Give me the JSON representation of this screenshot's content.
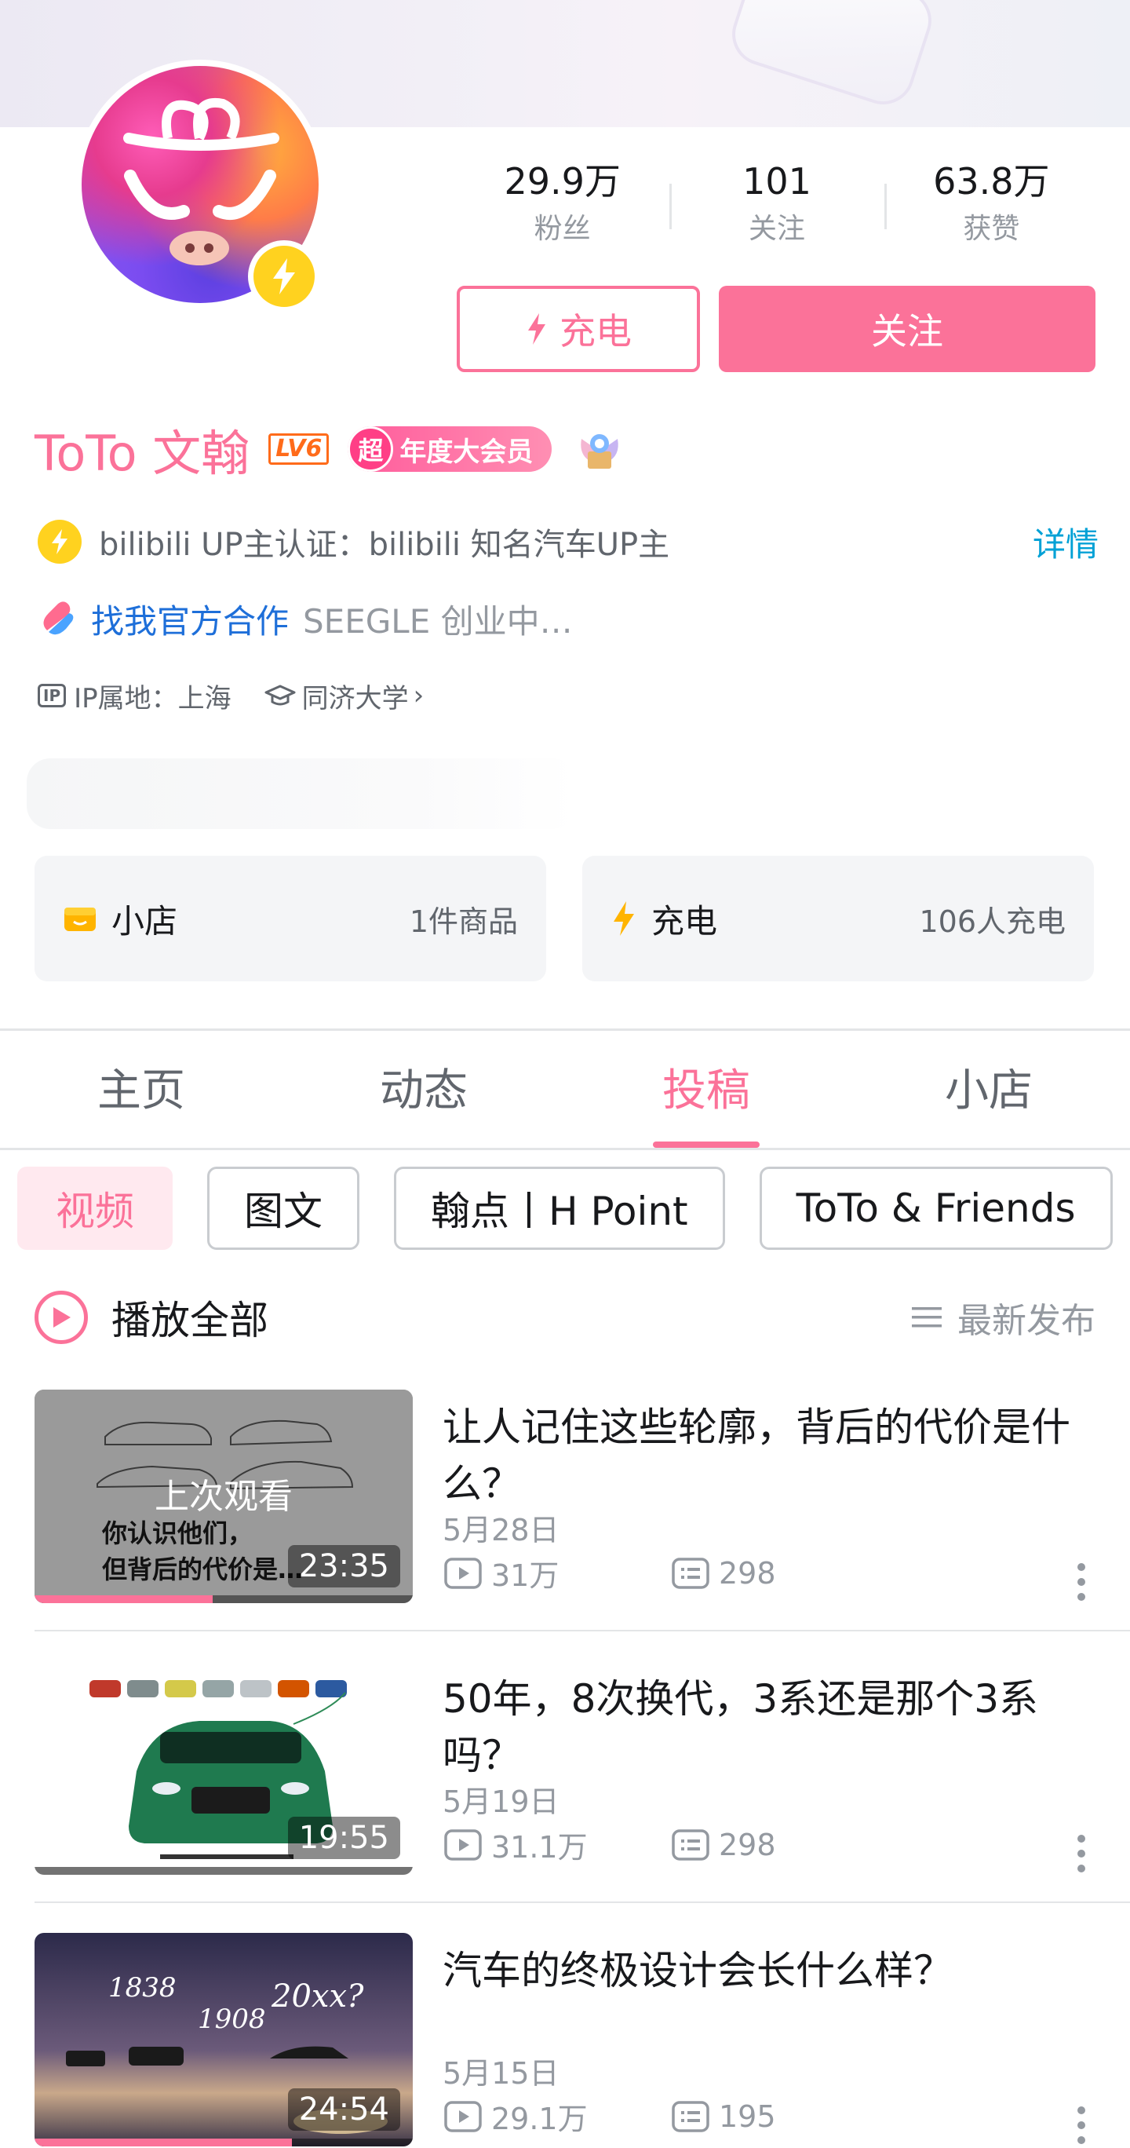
{
  "profile": {
    "name": "ToTo 文翰",
    "level": "LV6",
    "vip_prefix": "超",
    "vip_label": "年度大会员",
    "certification": "bilibili UP主认证：bilibili 知名汽车UP主",
    "certification_more": "详情",
    "cooperation_link": "找我官方合作",
    "cooperation_desc": "SEEGLE 创业中…",
    "ip_badge": "IP",
    "ip_location": "IP属地：上海",
    "school": "同济大学",
    "school_chevron": "›"
  },
  "stats": [
    {
      "value": "29.9万",
      "label": "粉丝"
    },
    {
      "value": "101",
      "label": "关注"
    },
    {
      "value": "63.8万",
      "label": "获赞"
    }
  ],
  "actions": {
    "charge": "充电",
    "follow": "关注"
  },
  "cards": {
    "shop_title": "小店",
    "shop_count": "1件商品",
    "charge_title": "充电",
    "charge_count": "106人充电"
  },
  "tabs": [
    "主页",
    "动态",
    "投稿",
    "小店"
  ],
  "active_tab": "投稿",
  "chips": [
    "视频",
    "图文",
    "翰点丨H Point",
    "ToTo & Friends"
  ],
  "active_chip": "视频",
  "list_header": {
    "play_all": "播放全部",
    "sort": "最新发布"
  },
  "videos": [
    {
      "title": "让人记住这些轮廓，背后的代价是什么？",
      "date": "5月28日",
      "views": "31万",
      "comments": "298",
      "duration": "23:35",
      "last_watched": "上次观看",
      "thumb_caption_1": "你认识他们，",
      "thumb_caption_2": "但背后的代价是…",
      "progress": 0.47
    },
    {
      "title": "50年，8次换代，3系还是那个3系吗？",
      "date": "5月19日",
      "views": "31.1万",
      "comments": "298",
      "duration": "19:55",
      "progress": 0
    },
    {
      "title": "汽车的终极设计会长什么样？",
      "date": "5月15日",
      "views": "29.1万",
      "comments": "195",
      "duration": "24:54",
      "year_1": "1838",
      "year_2": "1908",
      "year_3": "20xx?",
      "progress": 0.68
    }
  ],
  "colors": {
    "accent": "#fb7299",
    "link": "#00a1d6",
    "vip": "#ff5b9b",
    "text_secondary": "#9499a0"
  }
}
